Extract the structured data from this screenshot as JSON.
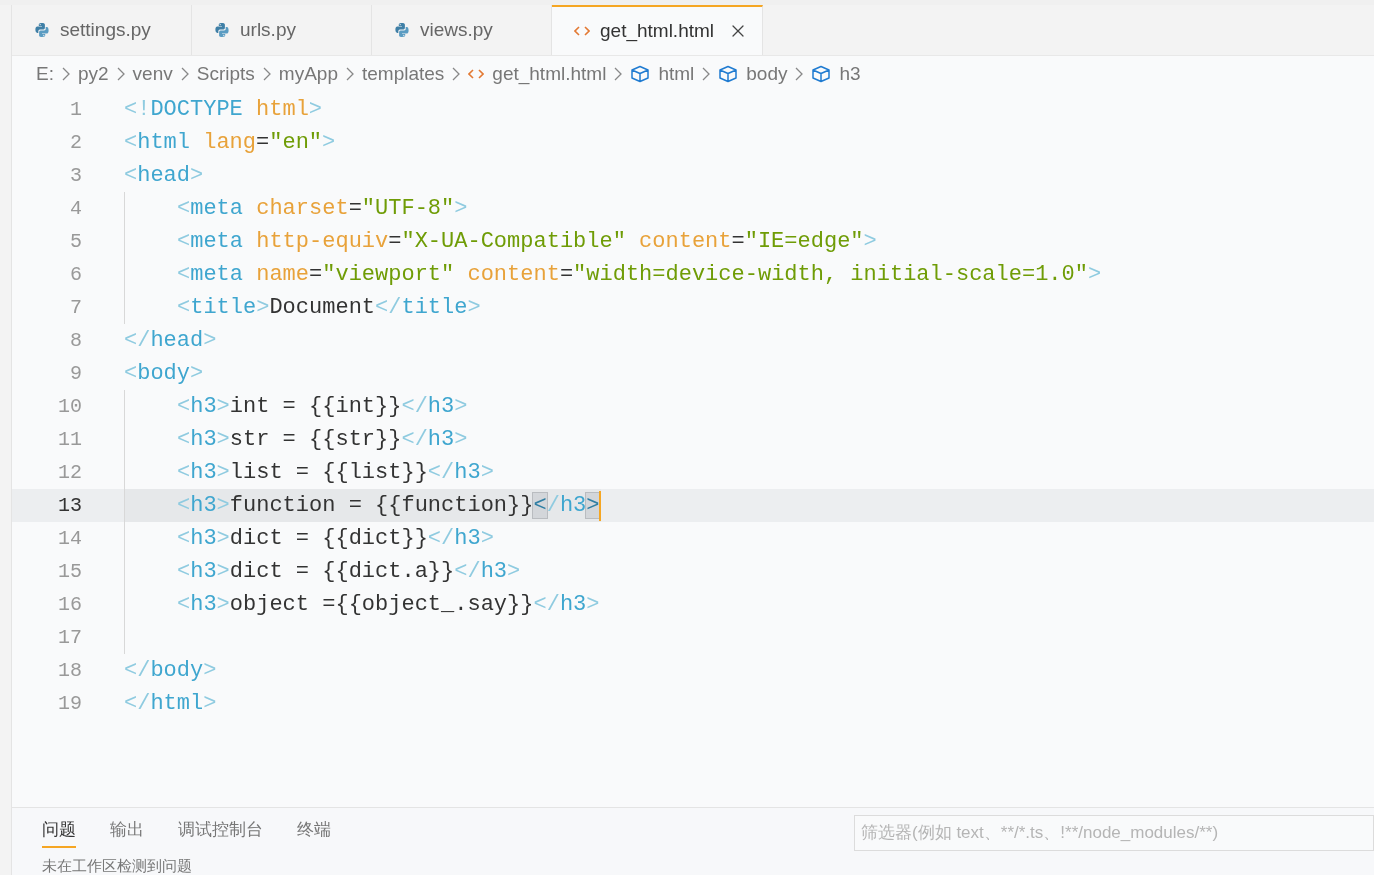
{
  "tabs": [
    {
      "label": "settings.py",
      "kind": "python",
      "selected": false
    },
    {
      "label": "urls.py",
      "kind": "python",
      "selected": false
    },
    {
      "label": "views.py",
      "kind": "python",
      "selected": false
    },
    {
      "label": "get_html.html",
      "kind": "html",
      "selected": true
    }
  ],
  "breadcrumb": [
    {
      "label": "E:",
      "kind": "folder"
    },
    {
      "label": "py2",
      "kind": "folder"
    },
    {
      "label": "venv",
      "kind": "folder"
    },
    {
      "label": "Scripts",
      "kind": "folder"
    },
    {
      "label": "myApp",
      "kind": "folder"
    },
    {
      "label": "templates",
      "kind": "folder"
    },
    {
      "label": "get_html.html",
      "kind": "html"
    },
    {
      "label": "html",
      "kind": "element"
    },
    {
      "label": "body",
      "kind": "element"
    },
    {
      "label": "h3",
      "kind": "element"
    }
  ],
  "lines": [
    {
      "number": "1",
      "indented": false,
      "selected": false,
      "tokens": [
        {
          "kind": "punct",
          "text": "<!"
        },
        {
          "kind": "tag",
          "text": "DOCTYPE"
        },
        {
          "kind": "attr",
          "text": " html"
        },
        {
          "kind": "punct",
          "text": ">"
        }
      ]
    },
    {
      "number": "2",
      "indented": false,
      "selected": false,
      "tokens": [
        {
          "kind": "punct",
          "text": "<"
        },
        {
          "kind": "tag",
          "text": "html"
        },
        {
          "kind": "attr",
          "text": " lang"
        },
        {
          "kind": "text",
          "text": "="
        },
        {
          "kind": "string",
          "text": "\"en\""
        },
        {
          "kind": "punct",
          "text": ">"
        }
      ]
    },
    {
      "number": "3",
      "indented": false,
      "selected": false,
      "tokens": [
        {
          "kind": "punct",
          "text": "<"
        },
        {
          "kind": "tag",
          "text": "head"
        },
        {
          "kind": "punct",
          "text": ">"
        }
      ]
    },
    {
      "number": "4",
      "indented": true,
      "selected": false,
      "tokens": [
        {
          "kind": "punct",
          "text": "<"
        },
        {
          "kind": "tag",
          "text": "meta"
        },
        {
          "kind": "attr",
          "text": " charset"
        },
        {
          "kind": "text",
          "text": "="
        },
        {
          "kind": "string",
          "text": "\"UTF-8\""
        },
        {
          "kind": "punct",
          "text": ">"
        }
      ]
    },
    {
      "number": "5",
      "indented": true,
      "selected": false,
      "tokens": [
        {
          "kind": "punct",
          "text": "<"
        },
        {
          "kind": "tag",
          "text": "meta"
        },
        {
          "kind": "attr",
          "text": " http-equiv"
        },
        {
          "kind": "text",
          "text": "="
        },
        {
          "kind": "string",
          "text": "\"X-UA-Compatible\""
        },
        {
          "kind": "attr",
          "text": " content"
        },
        {
          "kind": "text",
          "text": "="
        },
        {
          "kind": "string",
          "text": "\"IE=edge\""
        },
        {
          "kind": "punct",
          "text": ">"
        }
      ]
    },
    {
      "number": "6",
      "indented": true,
      "selected": false,
      "tokens": [
        {
          "kind": "punct",
          "text": "<"
        },
        {
          "kind": "tag",
          "text": "meta"
        },
        {
          "kind": "attr",
          "text": " name"
        },
        {
          "kind": "text",
          "text": "="
        },
        {
          "kind": "string",
          "text": "\"viewport\""
        },
        {
          "kind": "attr",
          "text": " content"
        },
        {
          "kind": "text",
          "text": "="
        },
        {
          "kind": "string",
          "text": "\"width=device-width, initial-scale=1.0\""
        },
        {
          "kind": "punct",
          "text": ">"
        }
      ]
    },
    {
      "number": "7",
      "indented": true,
      "selected": false,
      "tokens": [
        {
          "kind": "punct",
          "text": "<"
        },
        {
          "kind": "tag",
          "text": "title"
        },
        {
          "kind": "punct",
          "text": ">"
        },
        {
          "kind": "text",
          "text": "Document"
        },
        {
          "kind": "punct",
          "text": "</"
        },
        {
          "kind": "tag",
          "text": "title"
        },
        {
          "kind": "punct",
          "text": ">"
        }
      ]
    },
    {
      "number": "8",
      "indented": false,
      "selected": false,
      "tokens": [
        {
          "kind": "punct",
          "text": "</"
        },
        {
          "kind": "tag",
          "text": "head"
        },
        {
          "kind": "punct",
          "text": ">"
        }
      ]
    },
    {
      "number": "9",
      "indented": false,
      "selected": false,
      "tokens": [
        {
          "kind": "punct",
          "text": "<"
        },
        {
          "kind": "tag",
          "text": "body"
        },
        {
          "kind": "punct",
          "text": ">"
        }
      ]
    },
    {
      "number": "10",
      "indented": true,
      "selected": false,
      "tokens": [
        {
          "kind": "punct",
          "text": "<"
        },
        {
          "kind": "tag",
          "text": "h3"
        },
        {
          "kind": "punct",
          "text": ">"
        },
        {
          "kind": "text",
          "text": "int = {{int}}"
        },
        {
          "kind": "punct",
          "text": "</"
        },
        {
          "kind": "tag",
          "text": "h3"
        },
        {
          "kind": "punct",
          "text": ">"
        }
      ]
    },
    {
      "number": "11",
      "indented": true,
      "selected": false,
      "tokens": [
        {
          "kind": "punct",
          "text": "<"
        },
        {
          "kind": "tag",
          "text": "h3"
        },
        {
          "kind": "punct",
          "text": ">"
        },
        {
          "kind": "text",
          "text": "str = {{str}}"
        },
        {
          "kind": "punct",
          "text": "</"
        },
        {
          "kind": "tag",
          "text": "h3"
        },
        {
          "kind": "punct",
          "text": ">"
        }
      ]
    },
    {
      "number": "12",
      "indented": true,
      "selected": false,
      "tokens": [
        {
          "kind": "punct",
          "text": "<"
        },
        {
          "kind": "tag",
          "text": "h3"
        },
        {
          "kind": "punct",
          "text": ">"
        },
        {
          "kind": "text",
          "text": "list = {{list}}"
        },
        {
          "kind": "punct",
          "text": "</"
        },
        {
          "kind": "tag",
          "text": "h3"
        },
        {
          "kind": "punct",
          "text": ">"
        }
      ]
    },
    {
      "number": "13",
      "indented": true,
      "selected": true,
      "tokens": [
        {
          "kind": "punct",
          "text": "<"
        },
        {
          "kind": "tag",
          "text": "h3"
        },
        {
          "kind": "punct",
          "text": ">"
        },
        {
          "kind": "text",
          "text": "function = {{function}}"
        },
        {
          "kind": "match",
          "text": "<"
        },
        {
          "kind": "punct",
          "text": "/"
        },
        {
          "kind": "tag",
          "text": "h3"
        },
        {
          "kind": "match",
          "text": ">"
        }
      ]
    },
    {
      "number": "14",
      "indented": true,
      "selected": false,
      "tokens": [
        {
          "kind": "punct",
          "text": "<"
        },
        {
          "kind": "tag",
          "text": "h3"
        },
        {
          "kind": "punct",
          "text": ">"
        },
        {
          "kind": "text",
          "text": "dict = {{dict}}"
        },
        {
          "kind": "punct",
          "text": "</"
        },
        {
          "kind": "tag",
          "text": "h3"
        },
        {
          "kind": "punct",
          "text": ">"
        }
      ]
    },
    {
      "number": "15",
      "indented": true,
      "selected": false,
      "tokens": [
        {
          "kind": "punct",
          "text": "<"
        },
        {
          "kind": "tag",
          "text": "h3"
        },
        {
          "kind": "punct",
          "text": ">"
        },
        {
          "kind": "text",
          "text": "dict = {{dict.a}}"
        },
        {
          "kind": "punct",
          "text": "</"
        },
        {
          "kind": "tag",
          "text": "h3"
        },
        {
          "kind": "punct",
          "text": ">"
        }
      ]
    },
    {
      "number": "16",
      "indented": true,
      "selected": false,
      "tokens": [
        {
          "kind": "punct",
          "text": "<"
        },
        {
          "kind": "tag",
          "text": "h3"
        },
        {
          "kind": "punct",
          "text": ">"
        },
        {
          "kind": "text",
          "text": "object ={{object_.say}}"
        },
        {
          "kind": "punct",
          "text": "</"
        },
        {
          "kind": "tag",
          "text": "h3"
        },
        {
          "kind": "punct",
          "text": ">"
        }
      ]
    },
    {
      "number": "17",
      "indented": true,
      "selected": false
    },
    {
      "number": "18",
      "indented": false,
      "selected": false,
      "tokens": [
        {
          "kind": "punct",
          "text": "</"
        },
        {
          "kind": "tag",
          "text": "body"
        },
        {
          "kind": "punct",
          "text": ">"
        }
      ]
    },
    {
      "number": "19",
      "indented": false,
      "selected": false,
      "tokens": [
        {
          "kind": "punct",
          "text": "</"
        },
        {
          "kind": "tag",
          "text": "html"
        },
        {
          "kind": "punct",
          "text": ">"
        }
      ]
    }
  ],
  "panel": {
    "tabs": [
      {
        "label": "问题",
        "selected": true
      },
      {
        "label": "输出",
        "selected": false
      },
      {
        "label": "调试控制台",
        "selected": false
      },
      {
        "label": "终端",
        "selected": false
      }
    ],
    "filter": {
      "placeholder": "筛选器(例如 text、**/*.ts、!**/node_modules/**)"
    },
    "message": "未在工作区检测到问题"
  }
}
